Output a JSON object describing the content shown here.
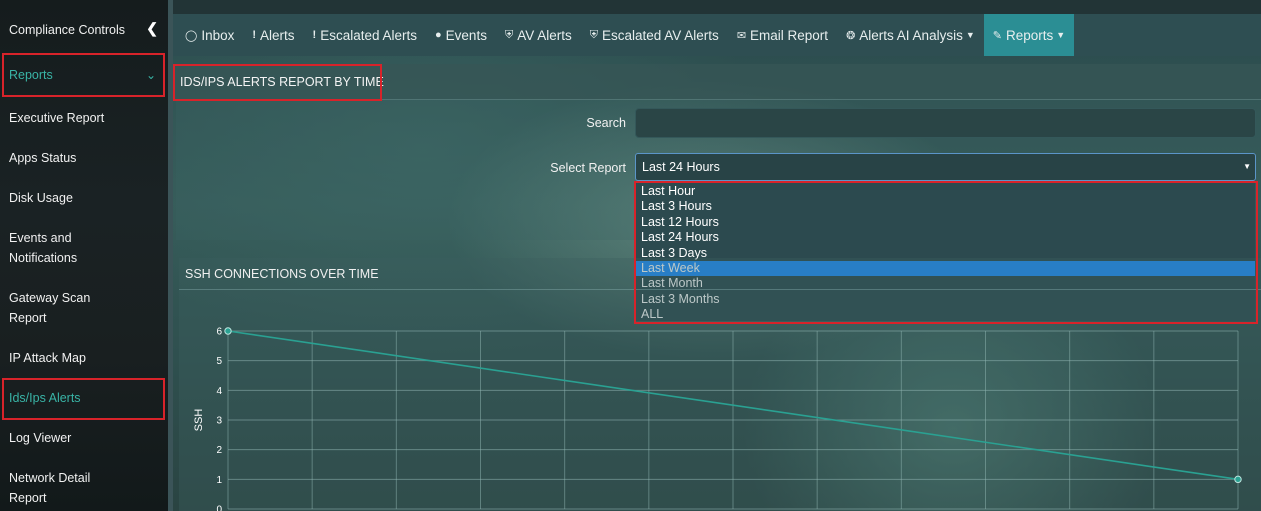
{
  "sidebar": {
    "items": [
      {
        "label": "Compliance Controls"
      },
      {
        "label": "Reports"
      },
      {
        "label": "Executive Report"
      },
      {
        "label": "Apps Status"
      },
      {
        "label": "Disk Usage"
      },
      {
        "label": "Events and"
      },
      {
        "label": "Notifications"
      },
      {
        "label": "Gateway Scan"
      },
      {
        "label": "Report"
      },
      {
        "label": "IP Attack Map"
      },
      {
        "label": "Ids/Ips Alerts"
      },
      {
        "label": "Log Viewer"
      },
      {
        "label": "Network Detail"
      },
      {
        "label": "Report"
      }
    ]
  },
  "nav": {
    "items": [
      {
        "label": "Inbox",
        "icon": "inbox-icon"
      },
      {
        "label": "Alerts",
        "icon": "exclamation-icon"
      },
      {
        "label": "Escalated Alerts",
        "icon": "exclamation-icon"
      },
      {
        "label": "Events",
        "icon": "exclamation-circle-icon"
      },
      {
        "label": "AV Alerts",
        "icon": "shield-icon"
      },
      {
        "label": "Escalated AV Alerts",
        "icon": "shield-icon"
      },
      {
        "label": "Email Report",
        "icon": "envelope-icon"
      },
      {
        "label": "Alerts AI Analysis",
        "icon": "ai-icon"
      },
      {
        "label": "Reports",
        "icon": "pencil-icon"
      }
    ]
  },
  "page": {
    "title": "IDS/IPS ALERTS REPORT BY TIME"
  },
  "form": {
    "search_label": "Search",
    "search_value": "",
    "select_label": "Select Report",
    "select_value": "Last 24 Hours",
    "options": [
      "Last Hour",
      "Last 3 Hours",
      "Last 12 Hours",
      "Last 24 Hours",
      "Last 3 Days",
      "Last Week",
      "Last Month",
      "Last 3 Months",
      "ALL"
    ],
    "highlighted_option": "Last Week"
  },
  "chart": {
    "title": "SSH CONNECTIONS OVER TIME"
  },
  "chart_data": {
    "type": "line",
    "ylabel": "SSH",
    "xlabel": "",
    "ylim": [
      0,
      6
    ],
    "y_ticks": [
      "0",
      "1",
      "2",
      "3",
      "4",
      "5",
      "6"
    ],
    "series": [
      {
        "values": [
          6,
          1
        ]
      }
    ],
    "colors": {
      "line": "#2aa192",
      "grid": "#8fb5b2"
    }
  },
  "colors": {
    "accent": "#39b4a6",
    "active_nav": "#2b8e94",
    "highlight": "#d8232a",
    "selected_option": "#1e8ffe"
  }
}
